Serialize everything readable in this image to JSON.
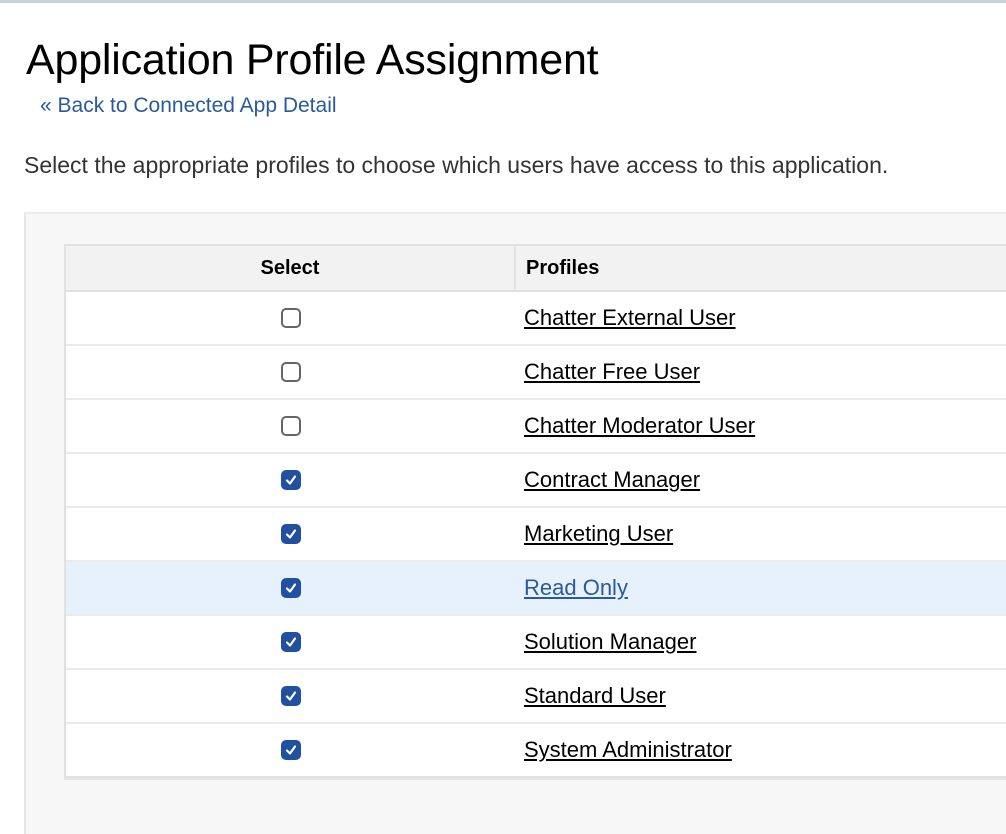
{
  "page": {
    "title": "Application Profile Assignment",
    "back_link": "« Back to Connected App Detail",
    "description": "Select the appropriate profiles to choose which users have access to this application."
  },
  "table": {
    "headers": {
      "select": "Select",
      "profiles": "Profiles"
    },
    "rows": [
      {
        "profile": "Chatter External User",
        "checked": false,
        "highlighted": false
      },
      {
        "profile": "Chatter Free User",
        "checked": false,
        "highlighted": false
      },
      {
        "profile": "Chatter Moderator User",
        "checked": false,
        "highlighted": false
      },
      {
        "profile": "Contract Manager",
        "checked": true,
        "highlighted": false
      },
      {
        "profile": "Marketing User",
        "checked": true,
        "highlighted": false
      },
      {
        "profile": "Read Only",
        "checked": true,
        "highlighted": true
      },
      {
        "profile": "Solution Manager",
        "checked": true,
        "highlighted": false
      },
      {
        "profile": "Standard User",
        "checked": true,
        "highlighted": false
      },
      {
        "profile": "System Administrator",
        "checked": true,
        "highlighted": false
      }
    ]
  },
  "colors": {
    "link": "#2a5a9c",
    "checkbox_checked": "#2150a0",
    "row_highlight": "#e6f1fb"
  }
}
